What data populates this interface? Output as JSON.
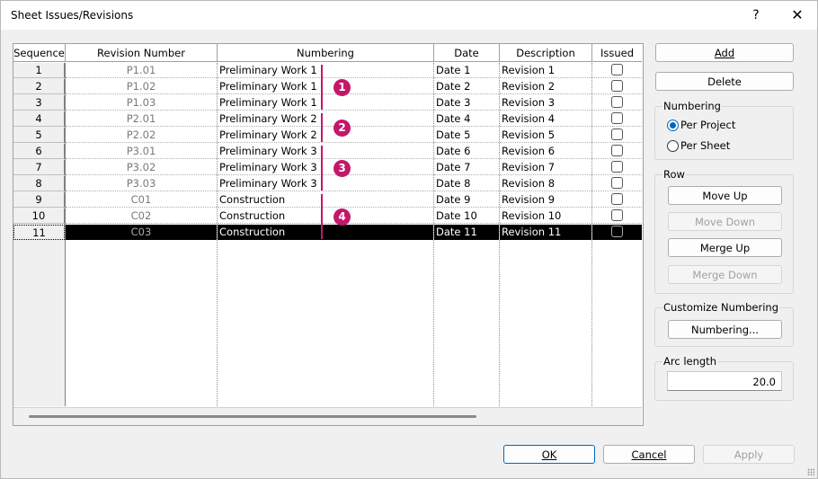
{
  "window": {
    "title": "Sheet Issues/Revisions",
    "help": "?",
    "close": "✕"
  },
  "table": {
    "headers": [
      "Sequence",
      "Revision Number",
      "Numbering",
      "Date",
      "Description",
      "Issued"
    ],
    "rows": [
      {
        "seq": "1",
        "rev": "P1.01",
        "numbering": "Preliminary Work 1",
        "date": "Date 1",
        "desc": "Revision 1",
        "issued": false
      },
      {
        "seq": "2",
        "rev": "P1.02",
        "numbering": "Preliminary Work 1",
        "date": "Date 2",
        "desc": "Revision 2",
        "issued": false
      },
      {
        "seq": "3",
        "rev": "P1.03",
        "numbering": "Preliminary Work 1",
        "date": "Date 3",
        "desc": "Revision 3",
        "issued": false
      },
      {
        "seq": "4",
        "rev": "P2.01",
        "numbering": "Preliminary Work 2",
        "date": "Date 4",
        "desc": "Revision 4",
        "issued": false
      },
      {
        "seq": "5",
        "rev": "P2.02",
        "numbering": "Preliminary Work 2",
        "date": "Date 5",
        "desc": "Revision 5",
        "issued": false
      },
      {
        "seq": "6",
        "rev": "P3.01",
        "numbering": "Preliminary Work 3",
        "date": "Date 6",
        "desc": "Revision 6",
        "issued": false
      },
      {
        "seq": "7",
        "rev": "P3.02",
        "numbering": "Preliminary Work 3",
        "date": "Date 7",
        "desc": "Revision 7",
        "issued": false
      },
      {
        "seq": "8",
        "rev": "P3.03",
        "numbering": "Preliminary Work 3",
        "date": "Date 8",
        "desc": "Revision 8",
        "issued": false
      },
      {
        "seq": "9",
        "rev": "C01",
        "numbering": "Construction",
        "date": "Date 9",
        "desc": "Revision 9",
        "issued": false
      },
      {
        "seq": "10",
        "rev": "C02",
        "numbering": "Construction",
        "date": "Date 10",
        "desc": "Revision 10",
        "issued": false
      },
      {
        "seq": "11",
        "rev": "C03",
        "numbering": "Construction",
        "date": "Date 11",
        "desc": "Revision 11",
        "issued": false
      }
    ],
    "selected_seq": "11"
  },
  "callouts": {
    "color": "#c2186b",
    "items": [
      {
        "label": "1",
        "first_row": 1,
        "last_row": 3
      },
      {
        "label": "2",
        "first_row": 4,
        "last_row": 5
      },
      {
        "label": "3",
        "first_row": 6,
        "last_row": 8
      },
      {
        "label": "4",
        "first_row": 9,
        "last_row": 11
      }
    ]
  },
  "buttons": {
    "add": "Add",
    "delete": "Delete"
  },
  "numbering_group": {
    "label": "Numbering",
    "per_project": "Per Project",
    "per_sheet": "Per Sheet",
    "selected": "per_project"
  },
  "row_group": {
    "label": "Row",
    "move_up": "Move Up",
    "move_down": "Move Down",
    "merge_up": "Merge Up",
    "merge_down": "Merge Down"
  },
  "customize_group": {
    "label": "Customize Numbering",
    "numbering_button": "Numbering..."
  },
  "arc_group": {
    "label": "Arc length",
    "value": "20.0"
  },
  "footer": {
    "ok": "OK",
    "cancel": "Cancel",
    "apply": "Apply"
  },
  "colors": {
    "accent": "#0067c0",
    "selection": "#000000"
  }
}
